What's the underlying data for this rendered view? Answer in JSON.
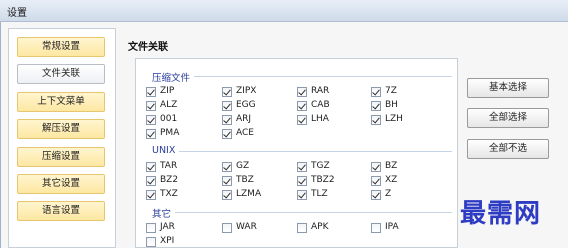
{
  "window": {
    "title": "设置"
  },
  "sidebar": {
    "items": [
      {
        "label": "常规设置",
        "active": false
      },
      {
        "label": "文件关联",
        "active": true
      },
      {
        "label": "上下文菜单",
        "active": false
      },
      {
        "label": "解压设置",
        "active": false
      },
      {
        "label": "压缩设置",
        "active": false
      },
      {
        "label": "其它设置",
        "active": false
      },
      {
        "label": "语言设置",
        "active": false
      }
    ]
  },
  "panel": {
    "title": "文件关联"
  },
  "groups": [
    {
      "title": "压缩文件",
      "items": [
        {
          "label": "ZIP",
          "checked": true
        },
        {
          "label": "ZIPX",
          "checked": true
        },
        {
          "label": "RAR",
          "checked": true
        },
        {
          "label": "7Z",
          "checked": true
        },
        {
          "label": "ALZ",
          "checked": true
        },
        {
          "label": "EGG",
          "checked": true
        },
        {
          "label": "CAB",
          "checked": true
        },
        {
          "label": "BH",
          "checked": true
        },
        {
          "label": "001",
          "checked": true
        },
        {
          "label": "ARJ",
          "checked": true
        },
        {
          "label": "LHA",
          "checked": true
        },
        {
          "label": "LZH",
          "checked": true
        },
        {
          "label": "PMA",
          "checked": true
        },
        {
          "label": "ACE",
          "checked": true
        }
      ]
    },
    {
      "title": "UNIX",
      "items": [
        {
          "label": "TAR",
          "checked": true
        },
        {
          "label": "GZ",
          "checked": true
        },
        {
          "label": "TGZ",
          "checked": true
        },
        {
          "label": "BZ",
          "checked": true
        },
        {
          "label": "BZ2",
          "checked": true
        },
        {
          "label": "TBZ",
          "checked": true
        },
        {
          "label": "TBZ2",
          "checked": true
        },
        {
          "label": "XZ",
          "checked": true
        },
        {
          "label": "TXZ",
          "checked": true
        },
        {
          "label": "LZMA",
          "checked": true
        },
        {
          "label": "TLZ",
          "checked": true
        },
        {
          "label": "Z",
          "checked": true
        }
      ]
    },
    {
      "title": "其它",
      "items": [
        {
          "label": "JAR",
          "checked": false
        },
        {
          "label": "WAR",
          "checked": false
        },
        {
          "label": "APK",
          "checked": false
        },
        {
          "label": "IPA",
          "checked": false
        },
        {
          "label": "XPI",
          "checked": false
        }
      ]
    }
  ],
  "buttons": {
    "basic": "基本选择",
    "select_all": "全部选择",
    "select_none": "全部不选"
  },
  "watermark": "最需网"
}
